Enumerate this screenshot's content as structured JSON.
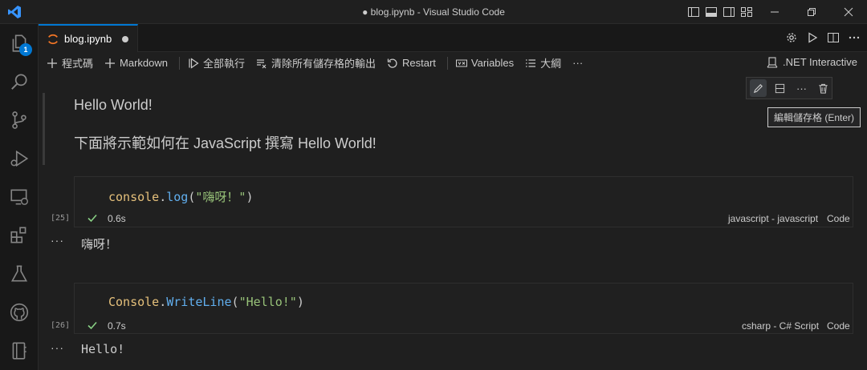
{
  "window": {
    "title": "● blog.ipynb - Visual Studio Code"
  },
  "activity_bar": {
    "explorer_badge": "1"
  },
  "tab": {
    "label": "blog.ipynb"
  },
  "toolbar": {
    "add_code": "程式碼",
    "add_markdown": "Markdown",
    "run_all": "全部執行",
    "clear_outputs": "清除所有儲存格的輸出",
    "restart": "Restart",
    "variables": "Variables",
    "outline": "大綱",
    "more": "···",
    "kernel": ".NET Interactive"
  },
  "markdown_cell": {
    "line1": "Hello World!",
    "line2": "下面將示範如何在 JavaScript 撰寫 Hello World!"
  },
  "cell_toolbar": {
    "more": "···"
  },
  "tooltip": {
    "text": "編輯儲存格 (Enter)"
  },
  "cells": [
    {
      "code": {
        "obj": "console",
        "dot": ".",
        "fn": "log",
        "open": "(",
        "str": "\"嗨呀！\"",
        "close": ")"
      },
      "exec_count": "[25]",
      "duration": "0.6s",
      "language": "javascript - javascript",
      "cell_type": "Code",
      "output_dots": "···",
      "output": "嗨呀！"
    },
    {
      "code": {
        "obj": "Console",
        "dot": ".",
        "fn": "WriteLine",
        "open": "(",
        "str": "\"Hello!\"",
        "close": ")"
      },
      "exec_count": "[26]",
      "duration": "0.7s",
      "language": "csharp - C# Script",
      "cell_type": "Code",
      "output_dots": "···",
      "output": "Hello!"
    }
  ],
  "colors": {
    "accent": "#0078d4",
    "success": "#89d185",
    "token_object": "#e5c07b",
    "token_function": "#61afef",
    "token_string": "#98c379"
  }
}
